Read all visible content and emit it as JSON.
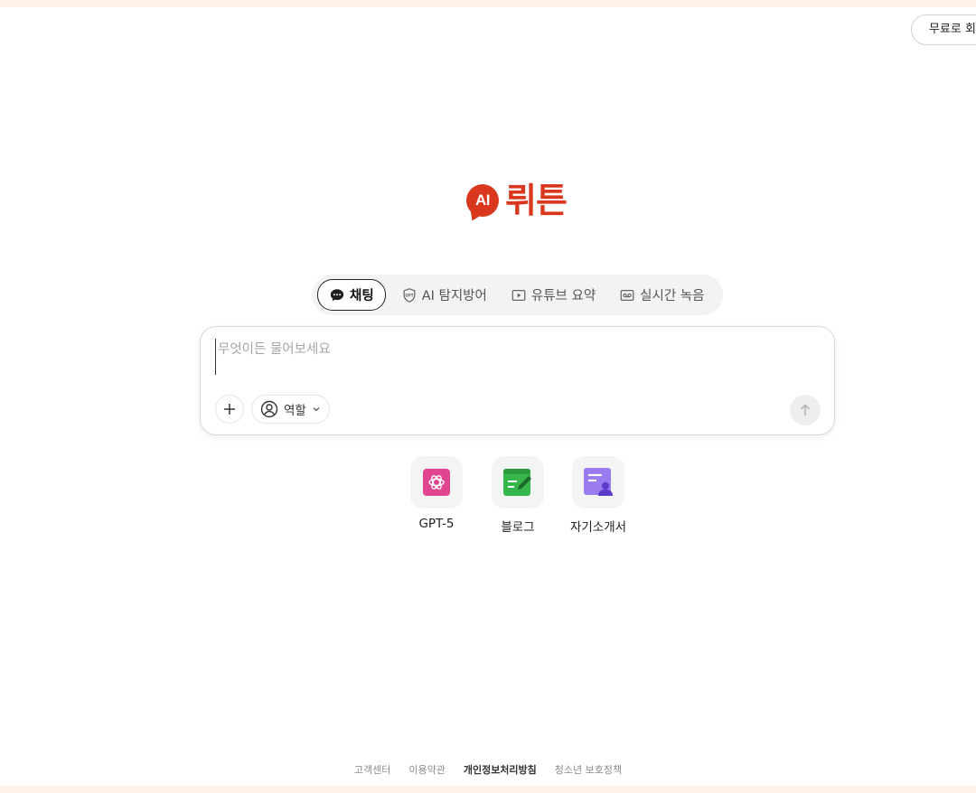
{
  "header": {
    "signup_label": "무료로 회원가입"
  },
  "logo": {
    "badge": "AI",
    "name": "뤼튼",
    "brand_color": "#d9381e"
  },
  "tabs": [
    {
      "label": "채팅",
      "icon": "chat-bubble-icon",
      "active": true
    },
    {
      "label": "AI 탐지방어",
      "icon": "gpt-shield-icon",
      "active": false
    },
    {
      "label": "유튜브 요약",
      "icon": "play-icon",
      "active": false
    },
    {
      "label": "실시간 녹음",
      "icon": "voicemail-icon",
      "active": false
    }
  ],
  "composer": {
    "placeholder": "무엇이든 물어보세요",
    "value": "",
    "role_label": "역할",
    "add_icon": "plus-icon",
    "role_icon": "user-circle-icon",
    "send_icon": "arrow-up-icon"
  },
  "quick_apps": [
    {
      "label": "GPT-5",
      "icon": "openai-icon",
      "color": "#e0468f"
    },
    {
      "label": "블로그",
      "icon": "blog-edit-icon",
      "color": "#37b64b"
    },
    {
      "label": "자기소개서",
      "icon": "resume-icon",
      "color": "#8f67e8"
    }
  ],
  "footer": {
    "links": [
      "고객센터",
      "이용약관",
      "개인정보처리방침",
      "청소년 보호정책"
    ]
  }
}
